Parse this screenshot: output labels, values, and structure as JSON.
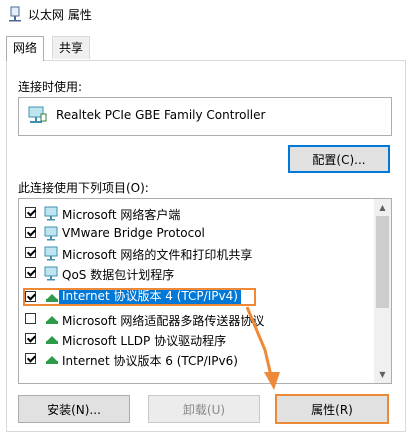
{
  "window": {
    "title": "以太网 属性"
  },
  "tabs": [
    {
      "label": "网络",
      "active": true
    },
    {
      "label": "共享",
      "active": false
    }
  ],
  "connect_using_label": "连接时使用:",
  "adapter": {
    "name": "Realtek PCIe GBE Family Controller",
    "icon": "network-adapter-icon"
  },
  "configure_button": "配置(C)...",
  "items_label": "此连接使用下列项目(O):",
  "items": [
    {
      "label": "Microsoft 网络客户端",
      "checked": true,
      "icon": "network-client-icon"
    },
    {
      "label": "VMware Bridge Protocol",
      "checked": true,
      "icon": "network-client-icon"
    },
    {
      "label": "Microsoft 网络的文件和打印机共享",
      "checked": true,
      "icon": "network-client-icon"
    },
    {
      "label": "QoS 数据包计划程序",
      "checked": true,
      "icon": "network-client-icon"
    },
    {
      "label": "Internet 协议版本 4 (TCP/IPv4)",
      "checked": true,
      "icon": "protocol-icon",
      "selected": true
    },
    {
      "label": "Microsoft 网络适配器多路传送器协议",
      "checked": false,
      "icon": "protocol-icon"
    },
    {
      "label": "Microsoft LLDP 协议驱动程序",
      "checked": true,
      "icon": "protocol-icon"
    },
    {
      "label": "Internet 协议版本 6 (TCP/IPv6)",
      "checked": true,
      "icon": "protocol-icon"
    }
  ],
  "buttons": {
    "install": "安装(N)...",
    "uninstall": "卸载(U)",
    "properties": "属性(R)"
  },
  "colors": {
    "selection": "#0078d7",
    "highlight": "#ee8a37"
  }
}
